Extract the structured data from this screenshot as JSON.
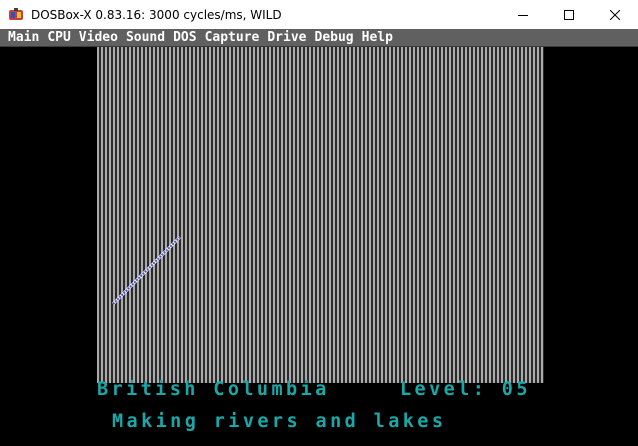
{
  "window": {
    "title": "DOSBox-X 0.83.16: 3000 cycles/ms, WILD",
    "icon": "dosbox-icon",
    "controls": [
      "minimize-icon",
      "maximize-icon",
      "close-icon"
    ]
  },
  "menu": {
    "items": [
      "Main",
      "CPU",
      "Video",
      "Sound",
      "DOS",
      "Capture",
      "Drive",
      "Debug",
      "Help"
    ]
  },
  "game": {
    "region": "British Columbia",
    "level_label": "Level:",
    "level_value": "05",
    "status": "Making rivers and lakes",
    "colors": {
      "text": "#19a8a8",
      "stripe_light": "#aaaaaa",
      "stripe_dark": "#2b2b2b",
      "river": "#4a52c8"
    }
  }
}
